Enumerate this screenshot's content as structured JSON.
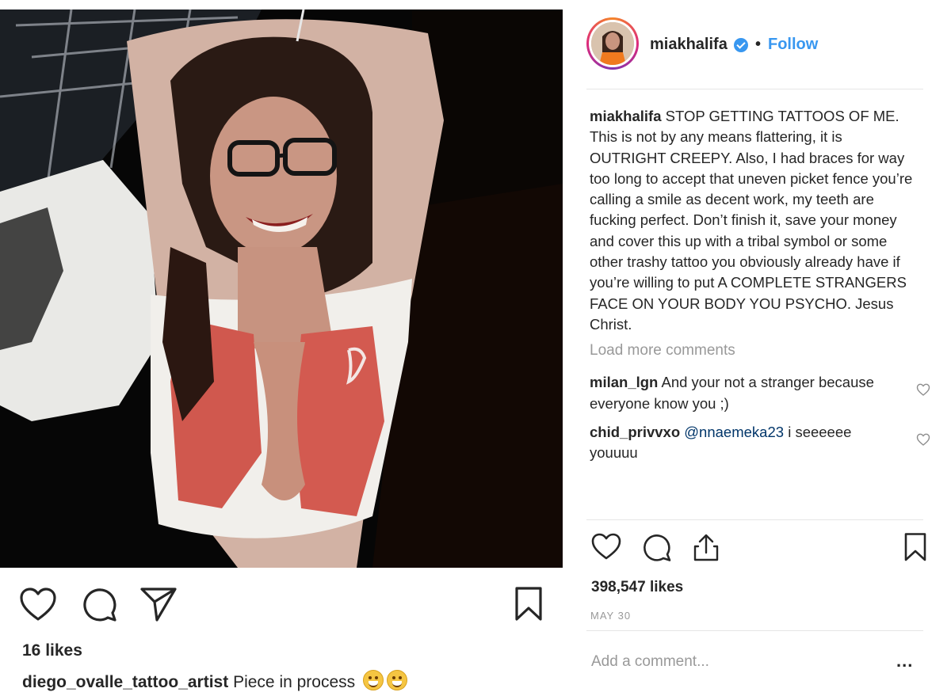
{
  "left_post": {
    "likes": "16 likes",
    "caption_user": "diego_ovalle_tattoo_artist",
    "caption_text": "Piece in process",
    "caption_emoji": "grinning-face-emoji"
  },
  "panel": {
    "username": "miakhalifa",
    "separator": "•",
    "follow_label": "Follow",
    "caption": {
      "user": "miakhalifa",
      "text": "STOP GETTING TATTOOS OF ME. This is not by any means flattering, it is OUTRIGHT CREEPY. Also, I had braces for way too long to accept that uneven picket fence you’re calling a smile as decent work, my teeth are fucking perfect. Don’t finish it, save your money and cover this up with a tribal symbol or some other trashy tattoo you obviously already have if you’re willing to put A COMPLETE STRANGERS FACE ON YOUR BODY YOU PSYCHO. Jesus Christ."
    },
    "load_more": "Load more comments",
    "comments": [
      {
        "user": "milan_lgn",
        "mention": "",
        "text": "And your not a stranger because everyone know you ;)"
      },
      {
        "user": "chid_privvxo",
        "mention": "@nnaemeka23",
        "text": "i seeeeee youuuu"
      }
    ],
    "likes": "398,547 likes",
    "date": "MAY 30",
    "add_comment_placeholder": "Add a comment...",
    "more_label": "..."
  },
  "colors": {
    "link_blue": "#3897f0",
    "muted_gray": "#999999",
    "text": "#262626"
  },
  "icons": {
    "left_actions": [
      "heart-icon",
      "comment-icon",
      "share-icon",
      "bookmark-icon"
    ],
    "right_actions": [
      "heart-icon",
      "comment-icon",
      "share-upload-icon",
      "bookmark-icon"
    ]
  }
}
